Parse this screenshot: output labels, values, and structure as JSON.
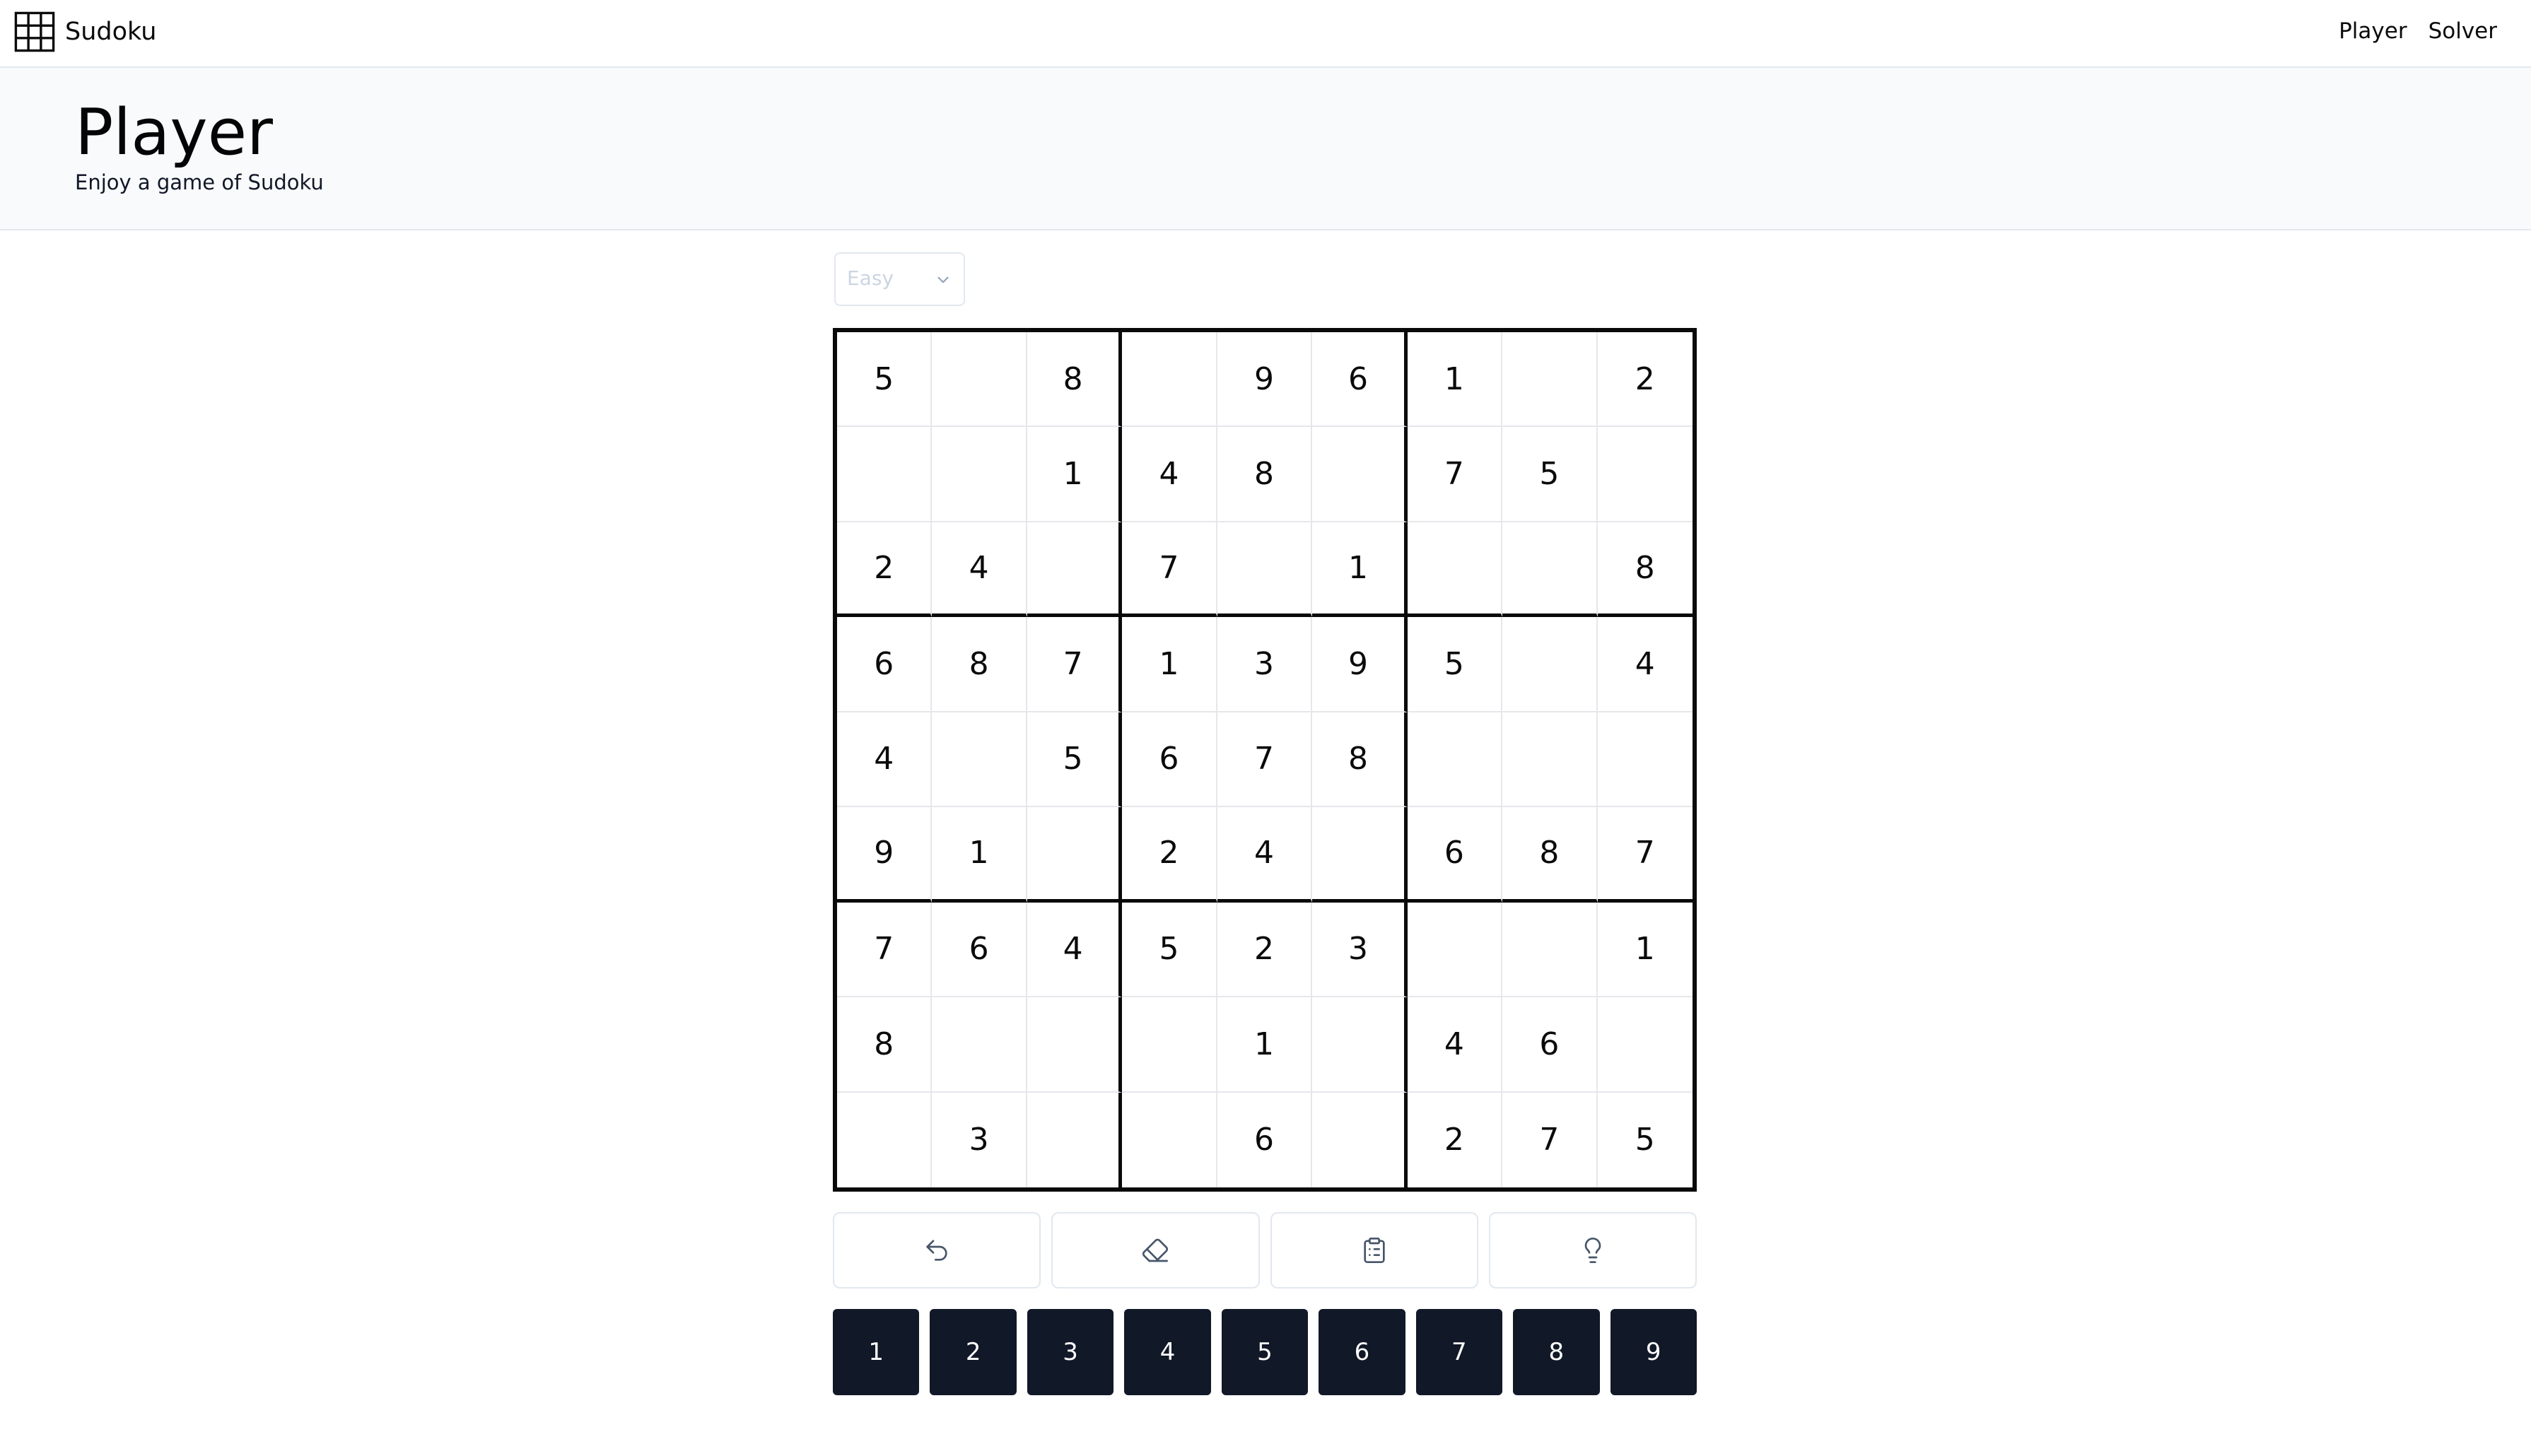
{
  "app": {
    "brand": "Sudoku",
    "brand_icon": "grid-icon"
  },
  "nav": {
    "player": "Player",
    "solver": "Solver"
  },
  "header": {
    "title": "Player",
    "subtitle": "Enjoy a game of Sudoku"
  },
  "difficulty": {
    "selected": "Easy",
    "icon": "chevron-down-icon"
  },
  "board": {
    "grid": [
      [
        "5",
        "",
        "8",
        "",
        "9",
        "6",
        "1",
        "",
        "2"
      ],
      [
        "",
        "",
        "1",
        "4",
        "8",
        "",
        "7",
        "5",
        ""
      ],
      [
        "2",
        "4",
        "",
        "7",
        "",
        "1",
        "",
        "",
        "8"
      ],
      [
        "6",
        "8",
        "7",
        "1",
        "3",
        "9",
        "5",
        "",
        "4"
      ],
      [
        "4",
        "",
        "5",
        "6",
        "7",
        "8",
        "",
        "",
        ""
      ],
      [
        "9",
        "1",
        "",
        "2",
        "4",
        "",
        "6",
        "8",
        "7"
      ],
      [
        "7",
        "6",
        "4",
        "5",
        "2",
        "3",
        "",
        "",
        "1"
      ],
      [
        "8",
        "",
        "",
        "",
        "1",
        "",
        "4",
        "6",
        ""
      ],
      [
        "",
        "3",
        "",
        "",
        "6",
        "",
        "2",
        "7",
        "5"
      ]
    ]
  },
  "tools": [
    {
      "name": "undo-button",
      "icon": "undo-icon"
    },
    {
      "name": "erase-button",
      "icon": "eraser-icon"
    },
    {
      "name": "notes-button",
      "icon": "notes-icon"
    },
    {
      "name": "hint-button",
      "icon": "lightbulb-icon"
    }
  ],
  "numpad": [
    "1",
    "2",
    "3",
    "4",
    "5",
    "6",
    "7",
    "8",
    "9"
  ],
  "colors": {
    "numpad_bg": "#111827",
    "header_bg": "#f8fafc",
    "border": "#e2e8f0",
    "board_line": "#0a0a0a"
  }
}
